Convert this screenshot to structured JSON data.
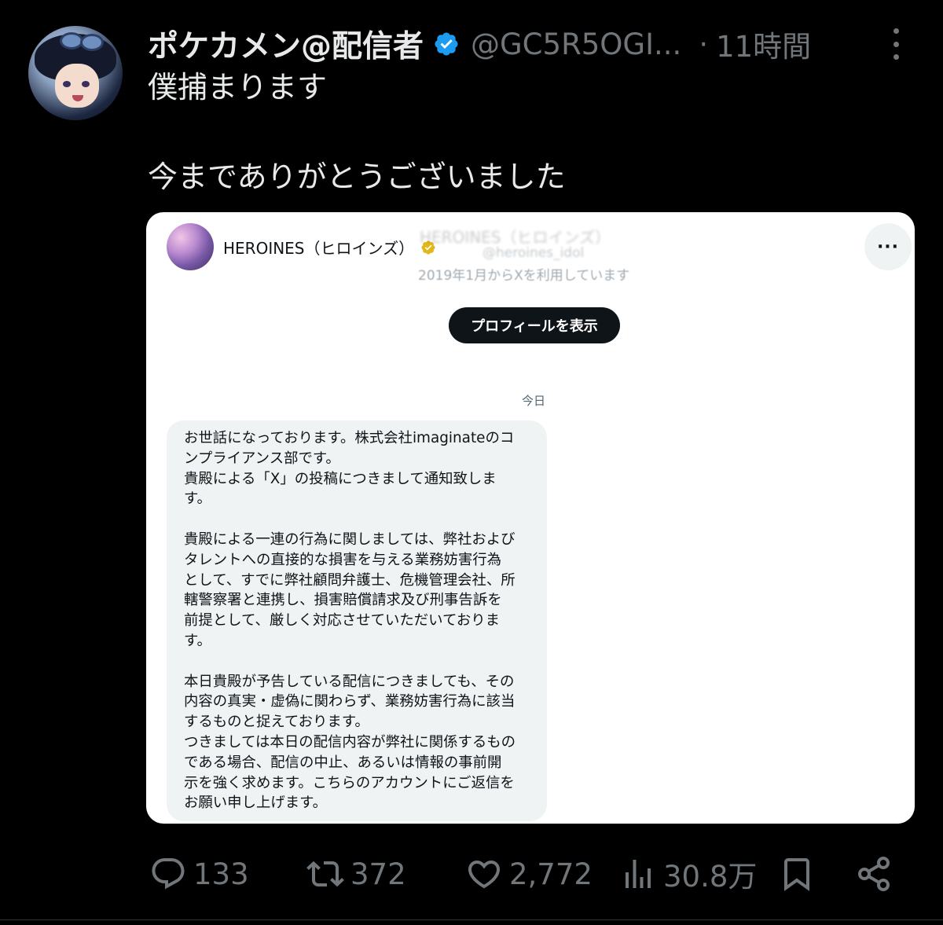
{
  "tweet": {
    "author_name": "ポケカメン@配信者",
    "handle": "@GC5R5OGI...",
    "separator": "·",
    "time": "11時間",
    "text_line1": "僕捕まります",
    "text_line2": "今までありがとうございました"
  },
  "embedded": {
    "dm_name": "HEROINES（ヒロインズ）",
    "blurred_name": "HEROINES（ヒロインズ）",
    "blurred_handle": "@heroines_idol",
    "joined": "2019年1月からXを利用しています",
    "more_label": "···",
    "profile_button": "プロフィールを表示",
    "date_label": "今日",
    "message_lines": [
      "お世話になっております。株式会社imaginateのコ",
      "ンプライアンス部です。",
      "貴殿による「X」の投稿につきまして通知致しま",
      "す。",
      "",
      "貴殿による一連の行為に関しましては、弊社および",
      "タレントへの直接的な損害を与える業務妨害行為",
      "として、すでに弊社顧問弁護士、危機管理会社、所",
      "轄警察署と連携し、損害賠償請求及び刑事告訴を",
      "前提として、厳しく対応させていただいておりま",
      "す。",
      "",
      "本日貴殿が予告している配信につきましても、その",
      "内容の真実・虚偽に関わらず、業務妨害行為に該当",
      "するものと捉えております。",
      "つきましては本日の配信内容が弊社に関係するもの",
      "である場合、配信の中止、あるいは情報の事前開",
      "示を強く求めます。こちらのアカウントにご返信を",
      "お願い申し上げます。"
    ]
  },
  "actions": {
    "replies": "133",
    "retweets": "372",
    "likes": "2,772",
    "views": "30.8万"
  },
  "colors": {
    "background": "#000000",
    "text_primary": "#e7e9ea",
    "text_secondary": "#71767b",
    "verified_blue": "#1d9bf0",
    "gold_badge": "#e2b719"
  },
  "icons": {
    "reply": "reply-icon",
    "retweet": "retweet-icon",
    "like": "heart-icon",
    "views": "views-icon",
    "bookmark": "bookmark-icon",
    "share": "share-icon",
    "more": "more-vertical-icon",
    "verified": "verified-badge-icon"
  }
}
